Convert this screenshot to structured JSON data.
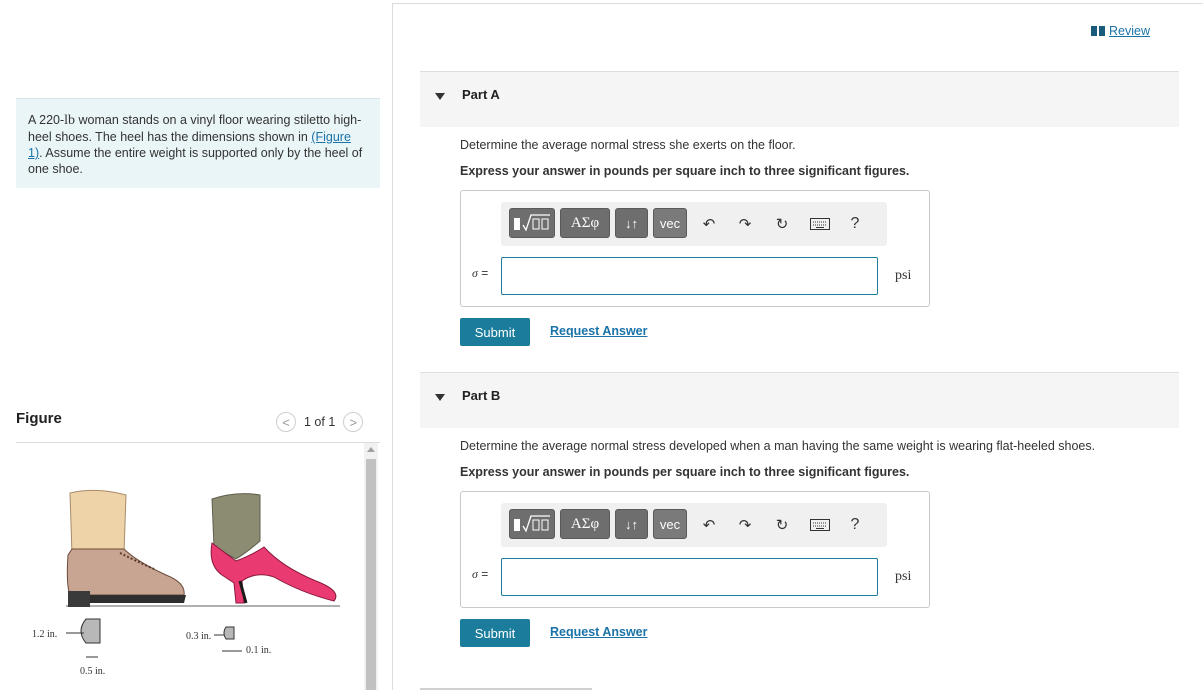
{
  "problem": {
    "text_before": "A 220-",
    "weight_unit": "lb",
    "text_middle": " woman stands on a vinyl floor wearing stiletto high-heel shoes. The heel has the dimensions shown in ",
    "figure_link": "(Figure 1)",
    "text_after": ". Assume the entire weight is supported only by the heel of one shoe."
  },
  "figure": {
    "title": "Figure",
    "pager_text": "1 of 1",
    "prev_label": "<",
    "next_label": ">",
    "dims": {
      "shoe1_height": "1.2 in.",
      "shoe1_width": "0.5 in.",
      "shoe2_height": "0.3 in.",
      "shoe2_width": "0.1 in."
    },
    "colors": {
      "skin": "#efd3a8",
      "brown_shoe": "#c8a493",
      "pink_shoe": "#ea3a72",
      "sock": "#8c8c73"
    }
  },
  "review": {
    "label": "Review"
  },
  "parts": [
    {
      "label": "Part A",
      "question": "Determine the average normal stress she exerts on the floor.",
      "instruction": "Express your answer in pounds per square inch to three significant figures.",
      "symbol": "σ",
      "equals": " =",
      "unit": "psi",
      "input_value": "",
      "submit_label": "Submit",
      "request_label": "Request Answer"
    },
    {
      "label": "Part B",
      "question": "Determine the average normal stress developed when a man having the same weight is wearing flat-heeled shoes.",
      "instruction": "Express your answer in pounds per square inch to three significant figures.",
      "symbol": "σ",
      "equals": " =",
      "unit": "psi",
      "input_value": "",
      "submit_label": "Submit",
      "request_label": "Request Answer"
    }
  ],
  "toolbar": {
    "greek_label": "ΑΣφ",
    "arrows_label": "↓↑",
    "vec_label": "vec",
    "help_label": "?"
  }
}
